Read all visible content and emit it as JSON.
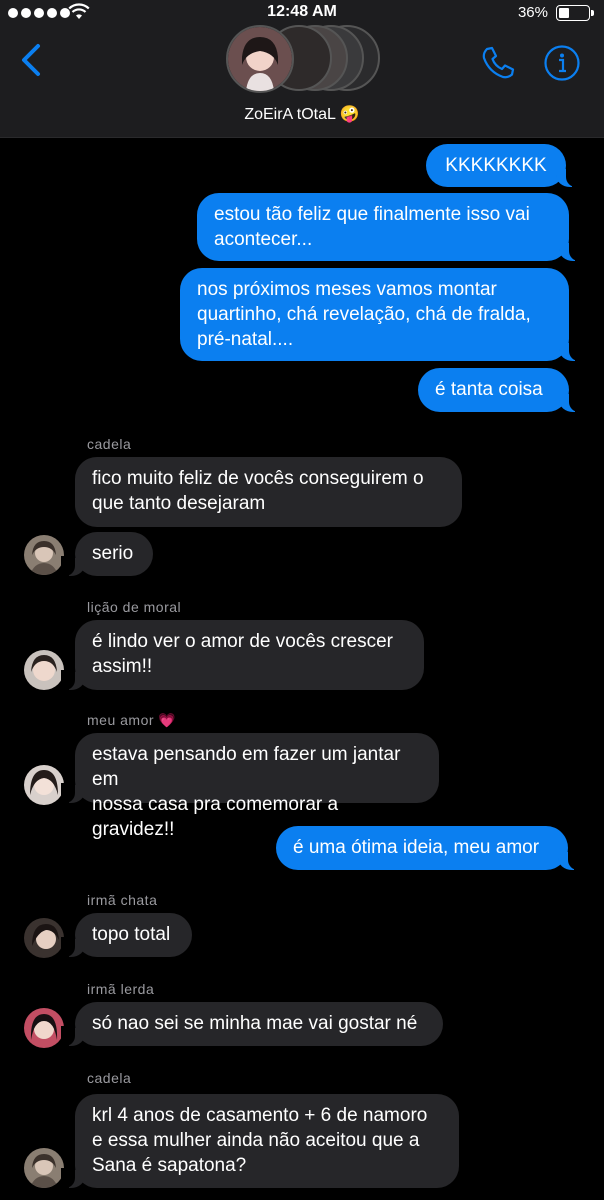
{
  "status_bar": {
    "time": "12:48 AM",
    "battery": "36%",
    "battery_level": 0.36
  },
  "header": {
    "title": "ZoEirA tOtaL 🤪",
    "back_icon": "chevron-left-icon",
    "call_icon": "phone-icon",
    "info_icon": "info-icon",
    "accent_color": "#0b7ff0"
  },
  "messages": [
    {
      "from": "me",
      "text": "KKKKKKKK"
    },
    {
      "from": "me",
      "text": "estou tão feliz que finalmente isso vai\nacontecer..."
    },
    {
      "from": "me",
      "text": "nos próximos meses vamos montar\nquartinho, chá revelação, chá de fralda,\npré-natal...."
    },
    {
      "from": "me",
      "text": "é tanta coisa"
    },
    {
      "sender": "cadela",
      "text": "fico muito feliz de vocês conseguirem o\nque tanto desejaram"
    },
    {
      "text": "serio"
    },
    {
      "sender": "lição de moral",
      "text": "é lindo ver o amor de vocês crescer\nassim!!"
    },
    {
      "sender": "meu amor 💗",
      "text": "estava pensando em fazer um jantar em\nnossa casa pra comemorar a gravidez!!"
    },
    {
      "from": "me",
      "text": "é uma ótima ideia, meu amor"
    },
    {
      "sender": "irmã chata",
      "text": "topo total"
    },
    {
      "sender": "irmã lerda",
      "text": "só nao sei se minha mae vai gostar né"
    },
    {
      "sender": "cadela",
      "text": "krl 4 anos de casamento + 6 de namoro\ne essa mulher ainda não aceitou que a\nSana é sapatona?"
    }
  ]
}
